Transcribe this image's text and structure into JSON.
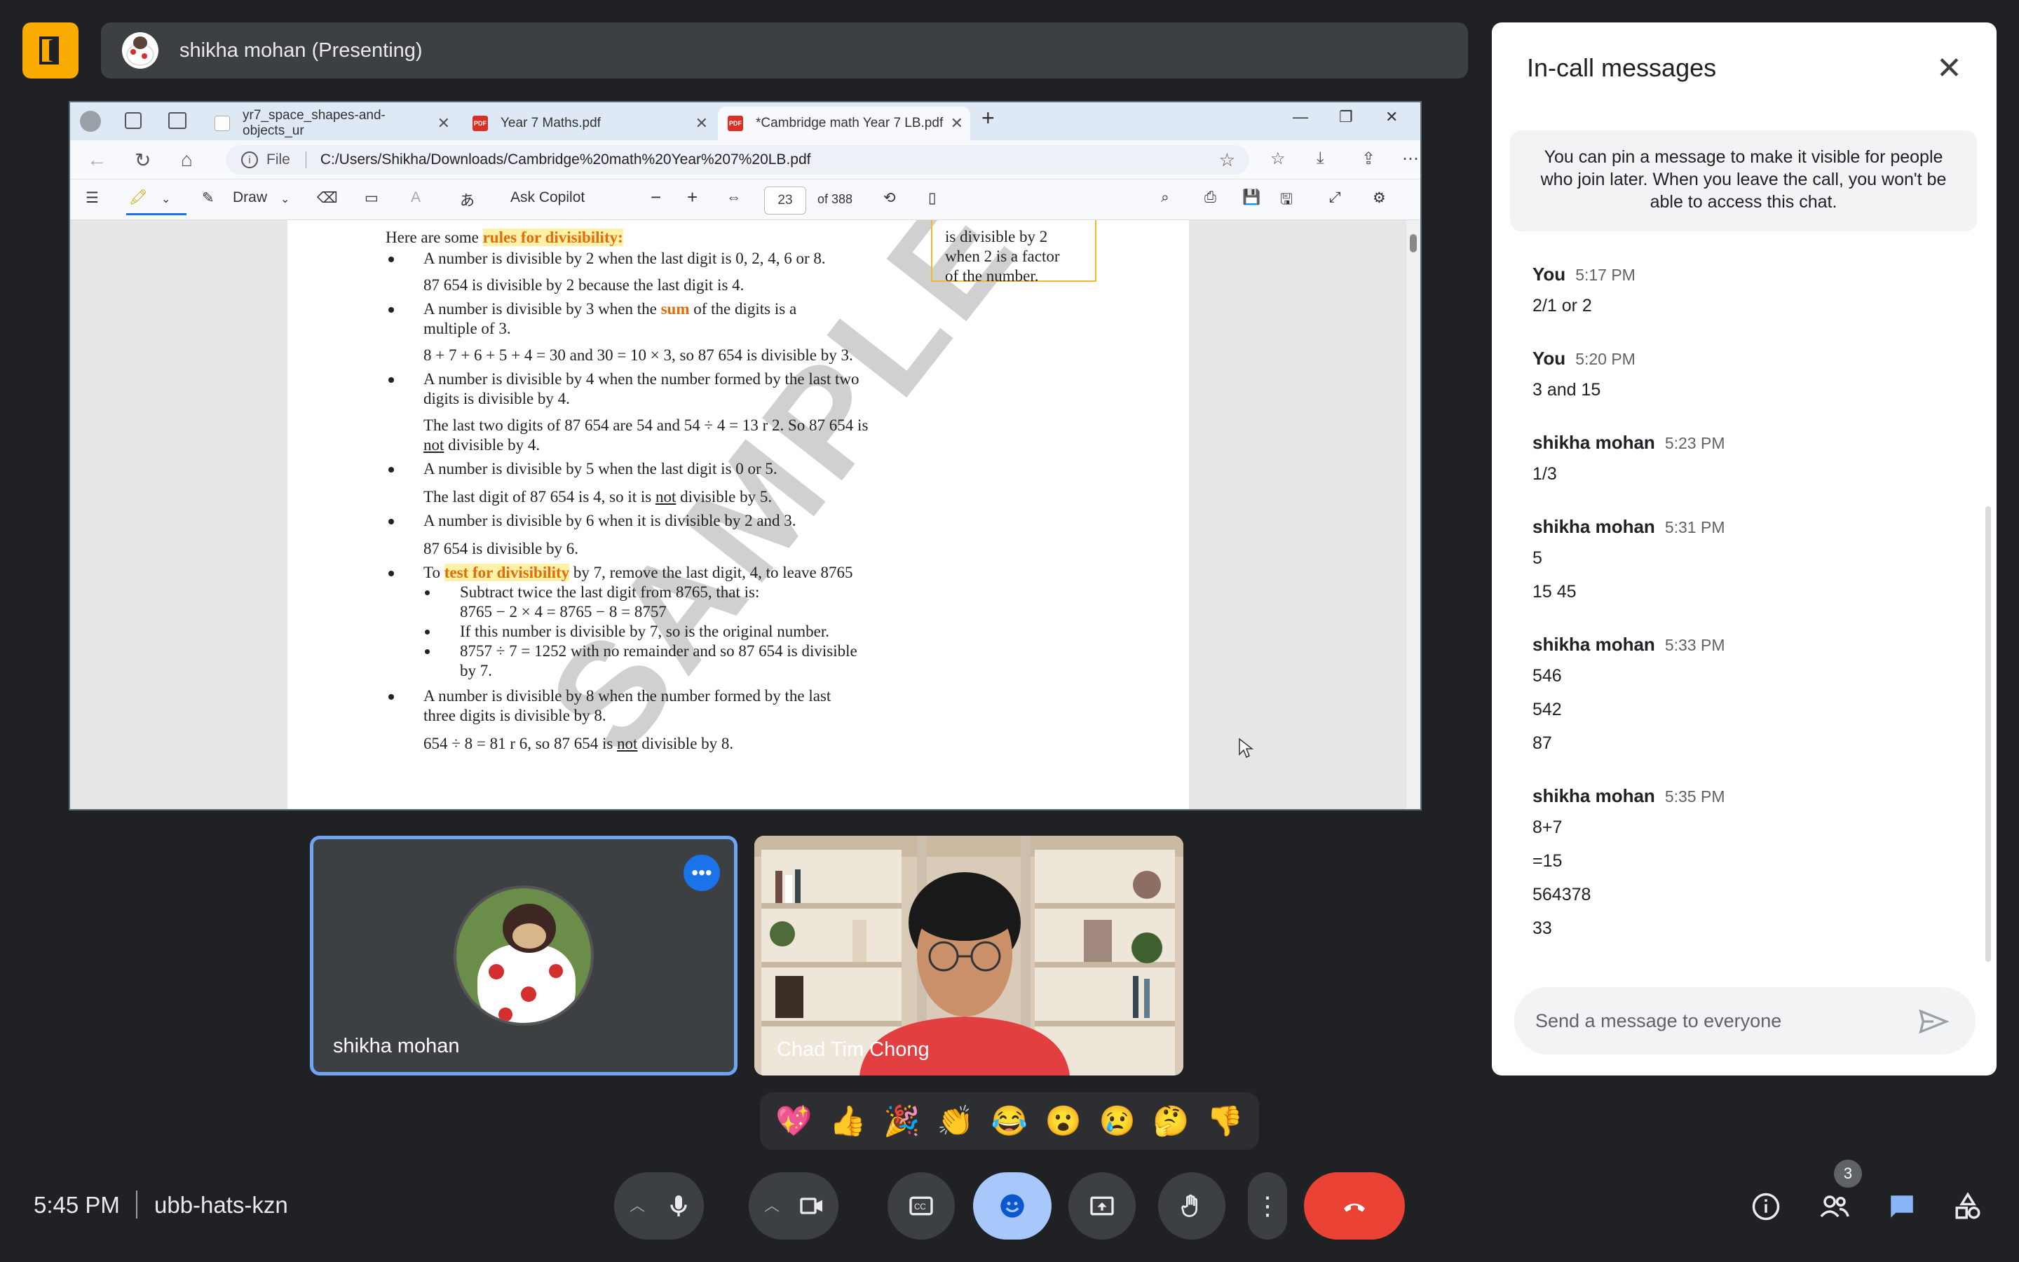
{
  "header": {
    "presenter_label": "shikha mohan (Presenting)"
  },
  "browser": {
    "tabs": [
      {
        "label": "yr7_space_shapes-and-objects_ur"
      },
      {
        "label": "Year 7 Maths.pdf"
      },
      {
        "label": "*Cambridge math Year 7 LB.pdf"
      }
    ],
    "address_prefix": "File",
    "url": "C:/Users/Shikha/Downloads/Cambridge%20math%20Year%207%20LB.pdf"
  },
  "pdf_toolbar": {
    "draw_label": "Draw",
    "copilot_label": "Ask Copilot",
    "page_current": "23",
    "page_total": "of 388"
  },
  "pdf_page": {
    "watermark": "SAMPLE",
    "sidebox_lines": [
      "is divisible by 2",
      "when 2 is a factor",
      "of the number."
    ],
    "intro_prefix": "Here are some ",
    "intro_highlight": "rules for divisibility:",
    "r2": "A number is divisible by 2 when the last digit is 0, 2, 4, 6 or 8.",
    "r2_ex": "87 654 is divisible by 2 because the last digit is 4.",
    "r3_a": "A number is divisible by 3 when the ",
    "r3_sum": "sum",
    "r3_b": " of the digits is a",
    "r3_c": "multiple of 3.",
    "r3_ex": "8 + 7 + 6 + 5 + 4 = 30 and 30 = 10 × 3, so 87 654 is divisible by 3.",
    "r4_a": "A number is divisible by 4 when the number formed by the last two",
    "r4_b": "digits is divisible by 4.",
    "r4_ex_a": "The last two digits of 87 654 are 54 and 54 ÷ 4 = 13 r 2. So 87 654 is",
    "r4_ex_not": "not",
    "r4_ex_b": " divisible by 4.",
    "r5": "A number is divisible by 5 when the last digit is 0 or 5.",
    "r5_ex_a": "The last digit of 87 654 is 4, so it is ",
    "r5_ex_not": "not",
    "r5_ex_b": " divisible by 5.",
    "r6": "A number is divisible by 6 when it is divisible by 2 and 3.",
    "r6_ex": "87 654 is divisible by 6.",
    "r7_a": "To ",
    "r7_test": "test for divisibility",
    "r7_b": " by 7, remove the last digit, 4, to leave 8765",
    "r7_s1": "Subtract twice the last digit from 8765, that is:",
    "r7_s1b": "8765 − 2 × 4 = 8765 − 8 = 8757",
    "r7_s2": "If this number is divisible by 7, so is the original number.",
    "r7_s3": "8757 ÷ 7 = 1252 with no remainder and so 87 654 is divisible",
    "r7_s3b": "by 7.",
    "r8_a": "A number is divisible by 8 when the number formed by the last",
    "r8_b": "three digits is divisible by 8.",
    "r8_ex_a": "654 ÷ 8 = 81 r 6, so 87 654 is ",
    "r8_ex_not": "not",
    "r8_ex_b": " divisible by 8."
  },
  "tiles": [
    {
      "name": "shikha mohan"
    },
    {
      "name": "Chad Tim Chong"
    }
  ],
  "reactions": [
    "💖",
    "👍",
    "🎉",
    "👏",
    "😂",
    "😮",
    "😢",
    "🤔",
    "👎"
  ],
  "footer": {
    "time": "5:45 PM",
    "meeting_code": "ubb-hats-kzn",
    "people_count": "3"
  },
  "chat": {
    "title": "In-call messages",
    "info": "You can pin a message to make it visible for people who join later. When you leave the call, you won't be able to access this chat.",
    "messages": [
      {
        "sender": "You",
        "time": "5:17 PM",
        "lines": [
          "2/1 or 2"
        ]
      },
      {
        "sender": "You",
        "time": "5:20 PM",
        "lines": [
          "3 and 15"
        ]
      },
      {
        "sender": "shikha mohan",
        "time": "5:23 PM",
        "lines": [
          "1/3"
        ]
      },
      {
        "sender": "shikha mohan",
        "time": "5:31 PM",
        "lines": [
          "5",
          "15 45"
        ]
      },
      {
        "sender": "shikha mohan",
        "time": "5:33 PM",
        "lines": [
          "546",
          "542",
          "87"
        ]
      },
      {
        "sender": "shikha mohan",
        "time": "5:35 PM",
        "lines": [
          "8+7",
          "=15",
          "564378",
          "33"
        ]
      }
    ],
    "input_placeholder": "Send a message to everyone"
  },
  "colors": {
    "accent_blue": "#1a73e8",
    "end_call_red": "#ea4335",
    "back_button_yellow": "#f9ab00",
    "reaction_active": "#8ab4f8"
  }
}
